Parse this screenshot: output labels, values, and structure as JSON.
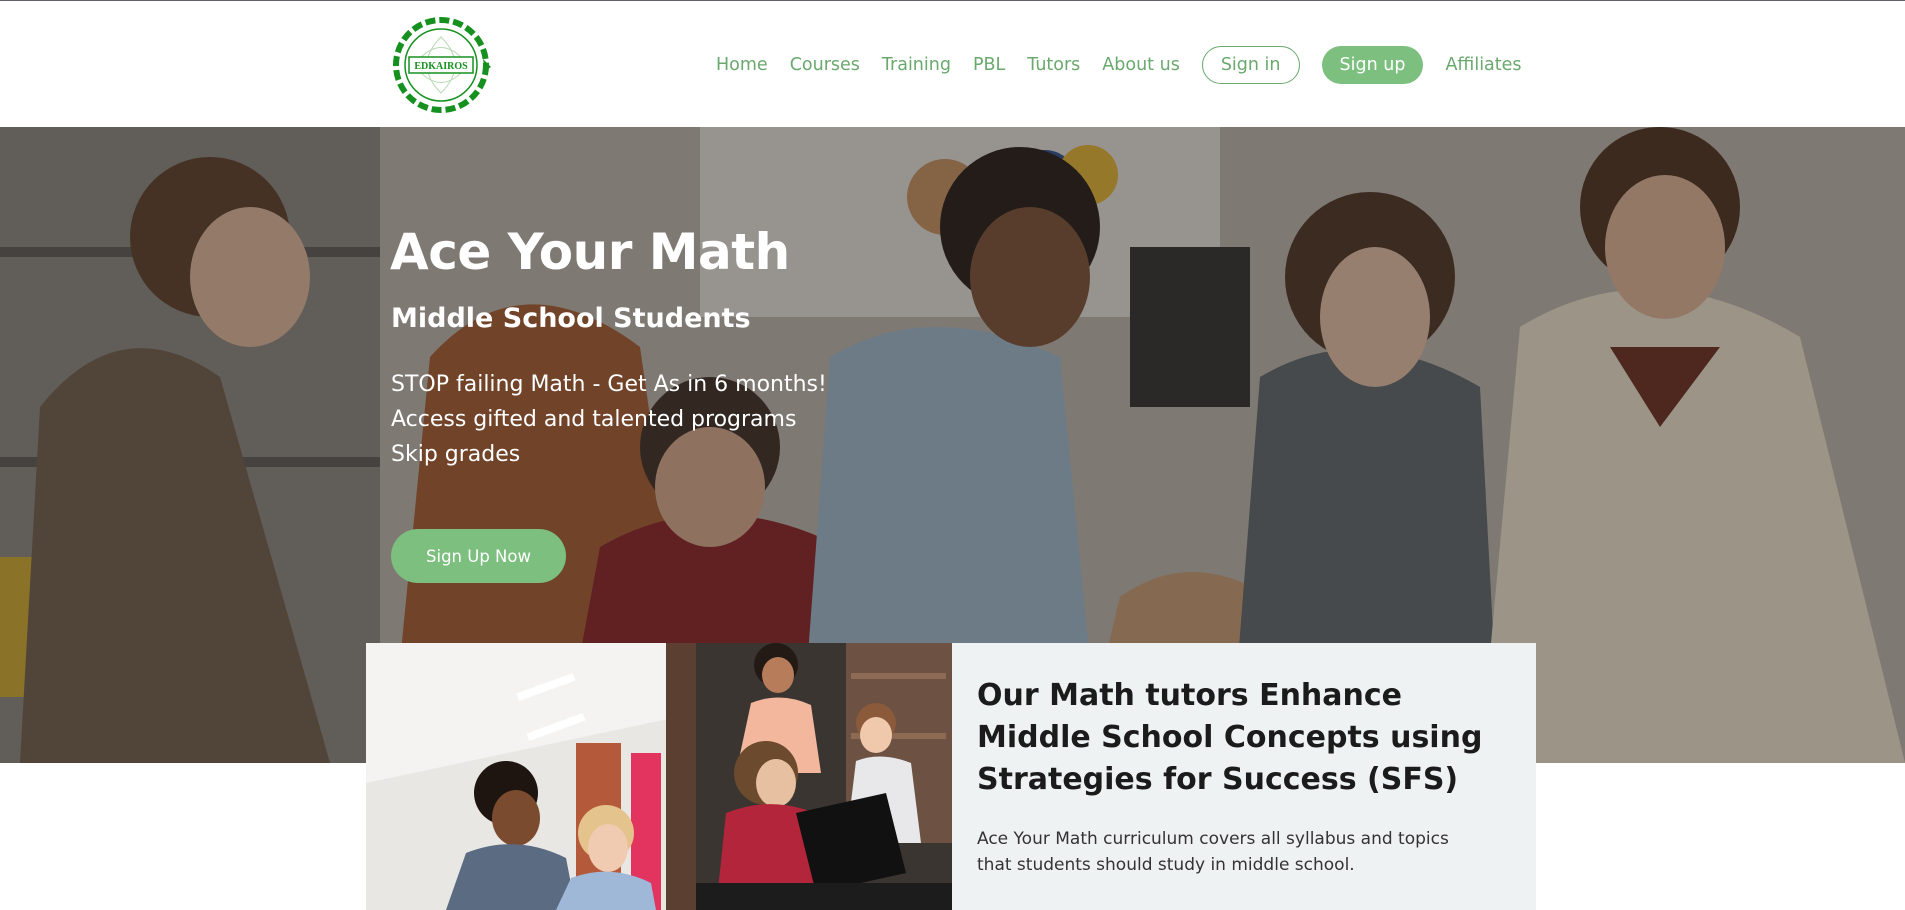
{
  "brand": {
    "logo_text": "EDKAIROS",
    "color": "#16911f"
  },
  "nav": {
    "items": [
      "Home",
      "Courses",
      "Training",
      "PBL",
      "Tutors",
      "About us"
    ],
    "sign_in": "Sign in",
    "sign_up": "Sign up",
    "affiliates": "Affiliates"
  },
  "hero": {
    "title": "Ace Your Math",
    "subtitle": "Middle School Students",
    "lines": [
      "STOP failing Math - Get As in 6 months!",
      "Access gifted and talented programs",
      "Skip grades"
    ],
    "cta": "Sign Up Now"
  },
  "feature": {
    "title": "Our Math tutors Enhance Middle School Concepts using Strategies for Success (SFS)",
    "text": "Ace Your Math curriculum covers all syllabus and topics that students should study in middle school."
  },
  "colors": {
    "accent": "#7cbf7f",
    "nav_text": "#6aa96e",
    "card_bg": "#eff2f3"
  }
}
